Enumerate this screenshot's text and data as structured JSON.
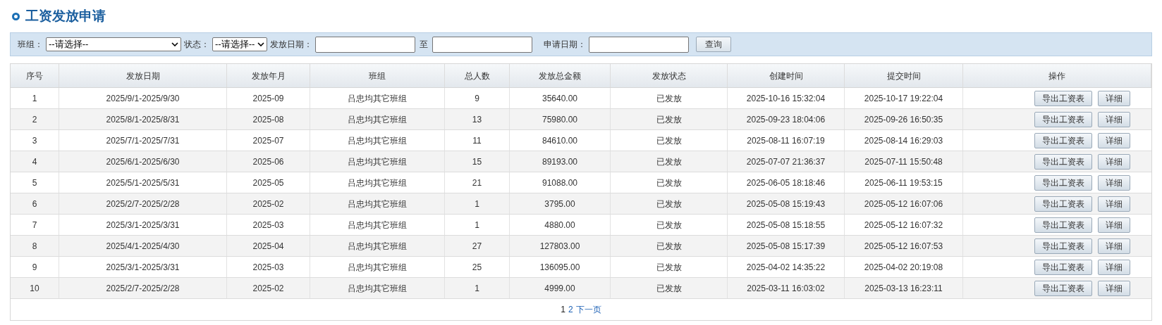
{
  "title": "工资发放申请",
  "filters": {
    "team_label": "班组：",
    "team_value": "--请选择--",
    "status_label": "状态：",
    "status_value": "--请选择--",
    "date_label": "发放日期：",
    "date_sep": "至",
    "apply_label": "申请日期：",
    "query_button": "查询"
  },
  "table": {
    "columns": [
      "序号",
      "发放日期",
      "发放年月",
      "班组",
      "总人数",
      "发放总金额",
      "发放状态",
      "创建时间",
      "提交时间",
      "操作"
    ],
    "rows": [
      {
        "cells": [
          "1",
          "2025/9/1-2025/9/30",
          "2025-09",
          "吕忠均其它班组",
          "9",
          "35640.00",
          "已发放",
          "2025-10-16 15:32:04",
          "2025-10-17 19:22:04"
        ],
        "actions": [
          "导出工资表",
          "详细"
        ]
      },
      {
        "cells": [
          "2",
          "2025/8/1-2025/8/31",
          "2025-08",
          "吕忠均其它班组",
          "13",
          "75980.00",
          "已发放",
          "2025-09-23 18:04:06",
          "2025-09-26 16:50:35"
        ],
        "actions": [
          "导出工资表",
          "详细"
        ]
      },
      {
        "cells": [
          "3",
          "2025/7/1-2025/7/31",
          "2025-07",
          "吕忠均其它班组",
          "11",
          "84610.00",
          "已发放",
          "2025-08-11 16:07:19",
          "2025-08-14 16:29:03"
        ],
        "actions": [
          "导出工资表",
          "详细"
        ]
      },
      {
        "cells": [
          "4",
          "2025/6/1-2025/6/30",
          "2025-06",
          "吕忠均其它班组",
          "15",
          "89193.00",
          "已发放",
          "2025-07-07 21:36:37",
          "2025-07-11 15:50:48"
        ],
        "actions": [
          "导出工资表",
          "详细"
        ]
      },
      {
        "cells": [
          "5",
          "2025/5/1-2025/5/31",
          "2025-05",
          "吕忠均其它班组",
          "21",
          "91088.00",
          "已发放",
          "2025-06-05 18:18:46",
          "2025-06-11 19:53:15"
        ],
        "actions": [
          "导出工资表",
          "详细"
        ]
      },
      {
        "cells": [
          "6",
          "2025/2/7-2025/2/28",
          "2025-02",
          "吕忠均其它班组",
          "1",
          "3795.00",
          "已发放",
          "2025-05-08 15:19:43",
          "2025-05-12 16:07:06"
        ],
        "actions": [
          "导出工资表",
          "详细"
        ]
      },
      {
        "cells": [
          "7",
          "2025/3/1-2025/3/31",
          "2025-03",
          "吕忠均其它班组",
          "1",
          "4880.00",
          "已发放",
          "2025-05-08 15:18:55",
          "2025-05-12 16:07:32"
        ],
        "actions": [
          "导出工资表",
          "详细"
        ]
      },
      {
        "cells": [
          "8",
          "2025/4/1-2025/4/30",
          "2025-04",
          "吕忠均其它班组",
          "27",
          "127803.00",
          "已发放",
          "2025-05-08 15:17:39",
          "2025-05-12 16:07:53"
        ],
        "actions": [
          "导出工资表",
          "详细"
        ]
      },
      {
        "cells": [
          "9",
          "2025/3/1-2025/3/31",
          "2025-03",
          "吕忠均其它班组",
          "25",
          "136095.00",
          "已发放",
          "2025-04-02 14:35:22",
          "2025-04-02 20:19:08"
        ],
        "actions": [
          "导出工资表",
          "详细"
        ]
      },
      {
        "cells": [
          "10",
          "2025/2/7-2025/2/28",
          "2025-02",
          "吕忠均其它班组",
          "1",
          "4999.00",
          "已发放",
          "2025-03-11 16:03:02",
          "2025-03-13 16:23:11"
        ],
        "actions": [
          "导出工资表",
          "详细"
        ]
      }
    ]
  },
  "pagination": {
    "pages": [
      {
        "label": "1",
        "selected": true
      },
      {
        "label": "2",
        "selected": false
      }
    ],
    "next": "下一页"
  }
}
